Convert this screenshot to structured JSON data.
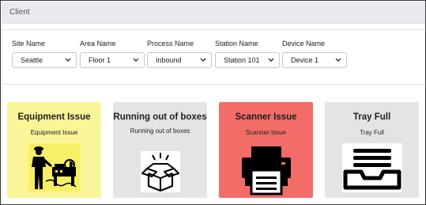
{
  "header": {
    "title": "Client"
  },
  "filters": [
    {
      "label": "Site Name",
      "value": "Seattle"
    },
    {
      "label": "Area Name",
      "value": "Floor 1"
    },
    {
      "label": "Process Name",
      "value": "Inbound"
    },
    {
      "label": "Station Name",
      "value": "Station 101"
    },
    {
      "label": "Device Name",
      "value": "Device 1"
    }
  ],
  "cards": [
    {
      "title": "Equipment Issue",
      "subtitle": "Equipment Issue",
      "color": "#fbf59a",
      "icon": "worker-machine-icon"
    },
    {
      "title": "Running out of boxes",
      "subtitle": "Running out of boxes",
      "color": "#e4e4e4",
      "icon": "open-box-icon"
    },
    {
      "title": "Scanner Issue",
      "subtitle": "Scanner Issue",
      "color": "#f36d68",
      "icon": "printer-icon"
    },
    {
      "title": "Tray Full",
      "subtitle": "Tray Full",
      "color": "#e4e4e4",
      "icon": "tray-icon"
    }
  ]
}
